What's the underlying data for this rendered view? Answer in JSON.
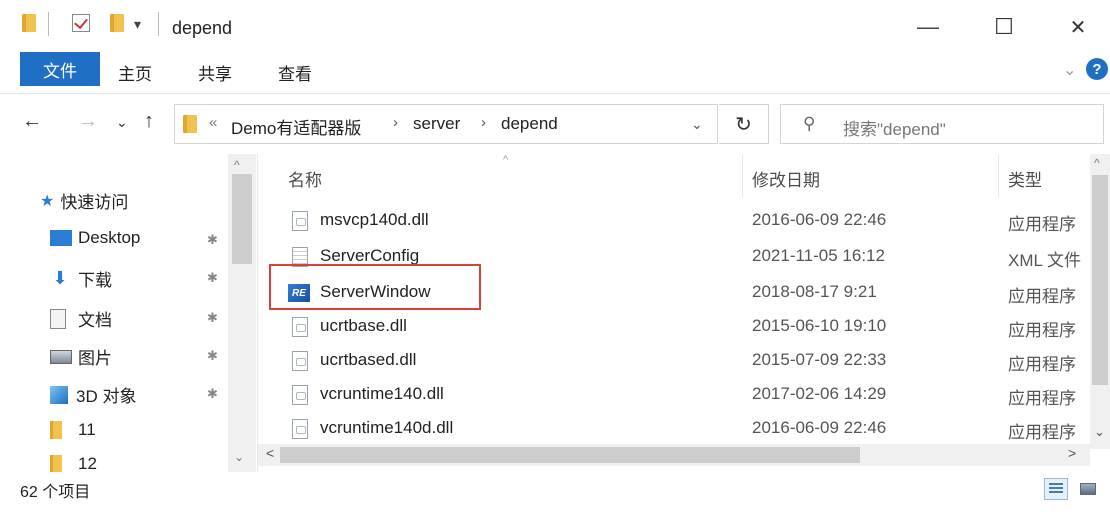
{
  "window": {
    "title": "depend",
    "minimize_glyph": "—",
    "maximize_glyph": "☐",
    "close_glyph": "✕",
    "qa_dropdown_glyph": "▾"
  },
  "ribbon": {
    "tabs": [
      "文件",
      "主页",
      "共享",
      "查看"
    ],
    "expand_glyph": "⌄",
    "help_glyph": "?"
  },
  "nav": {
    "back_glyph": "←",
    "forward_glyph": "→",
    "recent_glyph": "⌄",
    "up_glyph": "↑",
    "refresh_glyph": "↻",
    "breadcrumb": {
      "overflow": "«",
      "parts": [
        "Demo有适配器版",
        "server",
        "depend"
      ],
      "sep": "›",
      "dropdown_glyph": "⌄"
    },
    "search": {
      "placeholder": "搜索\"depend\"",
      "icon_glyph": "⚲"
    }
  },
  "sidebar": {
    "items": [
      {
        "label": "快速访问",
        "icon": "star-icon",
        "color": "#2b7cd3"
      },
      {
        "label": "Desktop",
        "icon": "desktop-icon",
        "pinned": true,
        "color": "#2b7cd3"
      },
      {
        "label": "下载",
        "icon": "download-icon",
        "pinned": true,
        "color": "#2b7cd3"
      },
      {
        "label": "文档",
        "icon": "documents-icon",
        "pinned": true
      },
      {
        "label": "图片",
        "icon": "pictures-icon",
        "pinned": true
      },
      {
        "label": "3D 对象",
        "icon": "3d-objects-icon",
        "pinned": true,
        "color": "#2b7cd3"
      },
      {
        "label": "11",
        "icon": "folder-icon"
      },
      {
        "label": "12",
        "icon": "folder-icon"
      }
    ],
    "pin_glyph": "📌",
    "scroll_up_glyph": "^",
    "scroll_down_glyph": "⌄"
  },
  "filelist": {
    "columns": [
      "名称",
      "修改日期",
      "类型"
    ],
    "sort_glyph": "^",
    "rows": [
      {
        "name": "msvcp140d.dll",
        "date": "2016-06-09 22:46",
        "type": "应用程序",
        "icon": "dll-file-icon"
      },
      {
        "name": "ServerConfig",
        "date": "2021-11-05 16:12",
        "type": "XML 文件",
        "icon": "xml-file-icon"
      },
      {
        "name": "ServerWindow",
        "date": "2018-08-17 9:21",
        "type": "应用程序",
        "icon": "app-icon",
        "highlighted": true
      },
      {
        "name": "ucrtbase.dll",
        "date": "2015-06-10 19:10",
        "type": "应用程序",
        "icon": "dll-file-icon"
      },
      {
        "name": "ucrtbased.dll",
        "date": "2015-07-09 22:33",
        "type": "应用程序",
        "icon": "dll-file-icon"
      },
      {
        "name": "vcruntime140.dll",
        "date": "2017-02-06 14:29",
        "type": "应用程序",
        "icon": "dll-file-icon"
      },
      {
        "name": "vcruntime140d.dll",
        "date": "2016-06-09 22:46",
        "type": "应用程序",
        "icon": "dll-file-icon"
      }
    ],
    "highlight_color": "#d9403a",
    "app_icon_text": "RE",
    "hscroll_left_glyph": "<",
    "hscroll_right_glyph": ">",
    "vscroll_up_glyph": "^",
    "vscroll_down_glyph": "⌄"
  },
  "status": {
    "count": "62 个项目"
  },
  "colors": {
    "accent": "#1f6fc4"
  }
}
